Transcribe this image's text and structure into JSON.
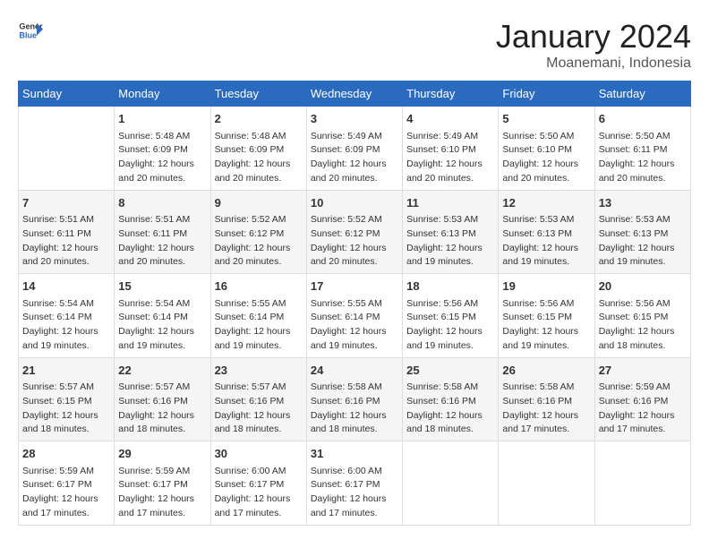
{
  "header": {
    "logo_general": "General",
    "logo_blue": "Blue",
    "title": "January 2024",
    "subtitle": "Moanemani, Indonesia"
  },
  "days_of_week": [
    "Sunday",
    "Monday",
    "Tuesday",
    "Wednesday",
    "Thursday",
    "Friday",
    "Saturday"
  ],
  "weeks": [
    [
      {
        "day": "",
        "info": ""
      },
      {
        "day": "1",
        "info": "Sunrise: 5:48 AM\nSunset: 6:09 PM\nDaylight: 12 hours\nand 20 minutes."
      },
      {
        "day": "2",
        "info": "Sunrise: 5:48 AM\nSunset: 6:09 PM\nDaylight: 12 hours\nand 20 minutes."
      },
      {
        "day": "3",
        "info": "Sunrise: 5:49 AM\nSunset: 6:09 PM\nDaylight: 12 hours\nand 20 minutes."
      },
      {
        "day": "4",
        "info": "Sunrise: 5:49 AM\nSunset: 6:10 PM\nDaylight: 12 hours\nand 20 minutes."
      },
      {
        "day": "5",
        "info": "Sunrise: 5:50 AM\nSunset: 6:10 PM\nDaylight: 12 hours\nand 20 minutes."
      },
      {
        "day": "6",
        "info": "Sunrise: 5:50 AM\nSunset: 6:11 PM\nDaylight: 12 hours\nand 20 minutes."
      }
    ],
    [
      {
        "day": "7",
        "info": "Sunrise: 5:51 AM\nSunset: 6:11 PM\nDaylight: 12 hours\nand 20 minutes."
      },
      {
        "day": "8",
        "info": "Sunrise: 5:51 AM\nSunset: 6:11 PM\nDaylight: 12 hours\nand 20 minutes."
      },
      {
        "day": "9",
        "info": "Sunrise: 5:52 AM\nSunset: 6:12 PM\nDaylight: 12 hours\nand 20 minutes."
      },
      {
        "day": "10",
        "info": "Sunrise: 5:52 AM\nSunset: 6:12 PM\nDaylight: 12 hours\nand 20 minutes."
      },
      {
        "day": "11",
        "info": "Sunrise: 5:53 AM\nSunset: 6:13 PM\nDaylight: 12 hours\nand 19 minutes."
      },
      {
        "day": "12",
        "info": "Sunrise: 5:53 AM\nSunset: 6:13 PM\nDaylight: 12 hours\nand 19 minutes."
      },
      {
        "day": "13",
        "info": "Sunrise: 5:53 AM\nSunset: 6:13 PM\nDaylight: 12 hours\nand 19 minutes."
      }
    ],
    [
      {
        "day": "14",
        "info": "Sunrise: 5:54 AM\nSunset: 6:14 PM\nDaylight: 12 hours\nand 19 minutes."
      },
      {
        "day": "15",
        "info": "Sunrise: 5:54 AM\nSunset: 6:14 PM\nDaylight: 12 hours\nand 19 minutes."
      },
      {
        "day": "16",
        "info": "Sunrise: 5:55 AM\nSunset: 6:14 PM\nDaylight: 12 hours\nand 19 minutes."
      },
      {
        "day": "17",
        "info": "Sunrise: 5:55 AM\nSunset: 6:14 PM\nDaylight: 12 hours\nand 19 minutes."
      },
      {
        "day": "18",
        "info": "Sunrise: 5:56 AM\nSunset: 6:15 PM\nDaylight: 12 hours\nand 19 minutes."
      },
      {
        "day": "19",
        "info": "Sunrise: 5:56 AM\nSunset: 6:15 PM\nDaylight: 12 hours\nand 19 minutes."
      },
      {
        "day": "20",
        "info": "Sunrise: 5:56 AM\nSunset: 6:15 PM\nDaylight: 12 hours\nand 18 minutes."
      }
    ],
    [
      {
        "day": "21",
        "info": "Sunrise: 5:57 AM\nSunset: 6:15 PM\nDaylight: 12 hours\nand 18 minutes."
      },
      {
        "day": "22",
        "info": "Sunrise: 5:57 AM\nSunset: 6:16 PM\nDaylight: 12 hours\nand 18 minutes."
      },
      {
        "day": "23",
        "info": "Sunrise: 5:57 AM\nSunset: 6:16 PM\nDaylight: 12 hours\nand 18 minutes."
      },
      {
        "day": "24",
        "info": "Sunrise: 5:58 AM\nSunset: 6:16 PM\nDaylight: 12 hours\nand 18 minutes."
      },
      {
        "day": "25",
        "info": "Sunrise: 5:58 AM\nSunset: 6:16 PM\nDaylight: 12 hours\nand 18 minutes."
      },
      {
        "day": "26",
        "info": "Sunrise: 5:58 AM\nSunset: 6:16 PM\nDaylight: 12 hours\nand 17 minutes."
      },
      {
        "day": "27",
        "info": "Sunrise: 5:59 AM\nSunset: 6:16 PM\nDaylight: 12 hours\nand 17 minutes."
      }
    ],
    [
      {
        "day": "28",
        "info": "Sunrise: 5:59 AM\nSunset: 6:17 PM\nDaylight: 12 hours\nand 17 minutes."
      },
      {
        "day": "29",
        "info": "Sunrise: 5:59 AM\nSunset: 6:17 PM\nDaylight: 12 hours\nand 17 minutes."
      },
      {
        "day": "30",
        "info": "Sunrise: 6:00 AM\nSunset: 6:17 PM\nDaylight: 12 hours\nand 17 minutes."
      },
      {
        "day": "31",
        "info": "Sunrise: 6:00 AM\nSunset: 6:17 PM\nDaylight: 12 hours\nand 17 minutes."
      },
      {
        "day": "",
        "info": ""
      },
      {
        "day": "",
        "info": ""
      },
      {
        "day": "",
        "info": ""
      }
    ]
  ]
}
